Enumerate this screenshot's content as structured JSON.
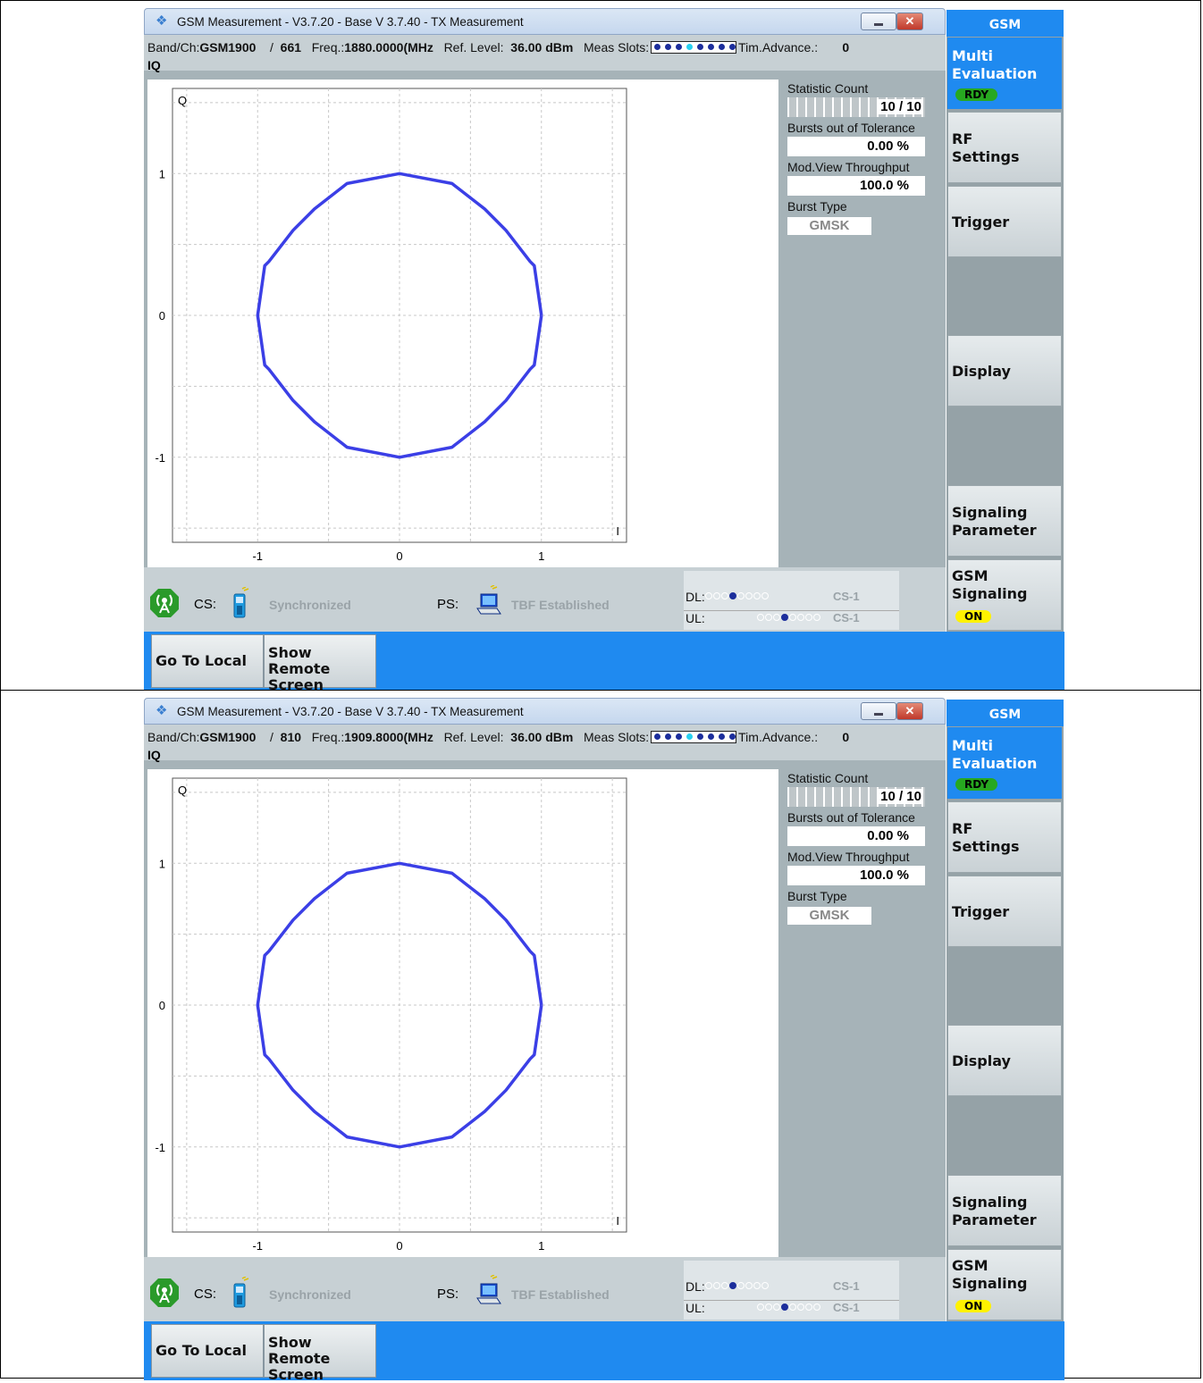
{
  "app": {
    "window_title": "GSM Measurement  - V3.7.20 - Base V 3.7.40 - TX Measurement",
    "close_glyph": "✕"
  },
  "panels": [
    {
      "band_ch_label": "Band/Ch:",
      "band": "GSM1900",
      "channel_sep": "/",
      "channel": "661",
      "freq_label": "Freq.:",
      "freq_value": "1880.0000(MHz",
      "ref_level_label": "Ref. Level:",
      "ref_level_value": "36.00 dBm",
      "meas_slots_label": "Meas Slots:",
      "tim_adv_label": "Tim.Advance.:",
      "tim_adv_value": "0"
    },
    {
      "band_ch_label": "Band/Ch:",
      "band": "GSM1900",
      "channel_sep": "/",
      "channel": "810",
      "freq_label": "Freq.:",
      "freq_value": "1909.8000(MHz",
      "ref_level_label": "Ref. Level:",
      "ref_level_value": "36.00 dBm",
      "meas_slots_label": "Meas Slots:",
      "tim_adv_label": "Tim.Advance.:",
      "tim_adv_value": "0"
    }
  ],
  "view_label": "IQ",
  "stats": {
    "statistic_count_label": "Statistic Count",
    "statistic_count_value": "10 / 10",
    "bursts_oot_label": "Bursts out of Tolerance",
    "bursts_oot_value": "0.00  %",
    "throughput_label": "Mod.View Throughput",
    "throughput_value": "100.0  %",
    "burst_type_label": "Burst Type",
    "burst_type_value": "GMSK"
  },
  "status": {
    "cs_label": "CS:",
    "cs_state": "Synchronized",
    "ps_label": "PS:",
    "ps_state": "TBF Established",
    "dl_label": "DL:",
    "ul_label": "UL:",
    "dl_code": "CS-1",
    "ul_code": "CS-1"
  },
  "sidebar": {
    "header": "GSM",
    "keys": [
      {
        "label": "Multi\nEvaluation",
        "badge": "RDY"
      },
      {
        "label": "RF\nSettings"
      },
      {
        "label": "Trigger"
      },
      {
        "label": ""
      },
      {
        "label": "Display"
      },
      {
        "label": ""
      },
      {
        "label": "Signaling\nParameter"
      },
      {
        "label": "GSM\nSignaling",
        "badge": "ON"
      }
    ]
  },
  "bottom": {
    "go_local": "Go To Local",
    "show_remote": "Show Remote\nScreen"
  },
  "chart_data": [
    {
      "type": "scatter",
      "title": "IQ",
      "xlabel": "I",
      "ylabel": "Q",
      "xlim": [
        -1.6,
        1.6
      ],
      "ylim": [
        -1.6,
        1.6
      ],
      "x_ticks": [
        -1,
        0,
        1
      ],
      "y_ticks": [
        1,
        0,
        -1
      ],
      "grid": true,
      "series_color": "#3b3fe6",
      "series": [
        {
          "x": [
            1.0,
            0.95,
            0.92,
            0.75,
            0.6,
            0.37,
            0.0,
            -0.37,
            -0.6,
            -0.75,
            -0.92,
            -0.95,
            -1.0,
            -0.95,
            -0.92,
            -0.75,
            -0.6,
            -0.37,
            0.0,
            0.37,
            0.6,
            0.75,
            0.92,
            0.95,
            1.0
          ],
          "y": [
            0.0,
            0.35,
            0.38,
            0.6,
            0.75,
            0.93,
            1.0,
            0.93,
            0.75,
            0.6,
            0.38,
            0.35,
            0.0,
            -0.35,
            -0.38,
            -0.6,
            -0.75,
            -0.93,
            -1.0,
            -0.93,
            -0.75,
            -0.6,
            -0.38,
            -0.35,
            0.0
          ]
        }
      ]
    },
    {
      "type": "scatter",
      "title": "IQ",
      "xlabel": "I",
      "ylabel": "Q",
      "xlim": [
        -1.6,
        1.6
      ],
      "ylim": [
        -1.6,
        1.6
      ],
      "x_ticks": [
        -1,
        0,
        1
      ],
      "y_ticks": [
        1,
        0,
        -1
      ],
      "grid": true,
      "series_color": "#3b3fe6",
      "series": [
        {
          "x": [
            1.0,
            0.95,
            0.92,
            0.75,
            0.6,
            0.37,
            0.0,
            -0.37,
            -0.6,
            -0.75,
            -0.92,
            -0.95,
            -1.0,
            -0.95,
            -0.92,
            -0.75,
            -0.6,
            -0.37,
            0.0,
            0.37,
            0.6,
            0.75,
            0.92,
            0.95,
            1.0
          ],
          "y": [
            0.0,
            0.35,
            0.38,
            0.6,
            0.75,
            0.93,
            1.0,
            0.93,
            0.75,
            0.6,
            0.38,
            0.35,
            0.0,
            -0.35,
            -0.38,
            -0.6,
            -0.75,
            -0.93,
            -1.0,
            -0.93,
            -0.75,
            -0.6,
            -0.38,
            -0.35,
            0.0
          ]
        }
      ]
    }
  ]
}
